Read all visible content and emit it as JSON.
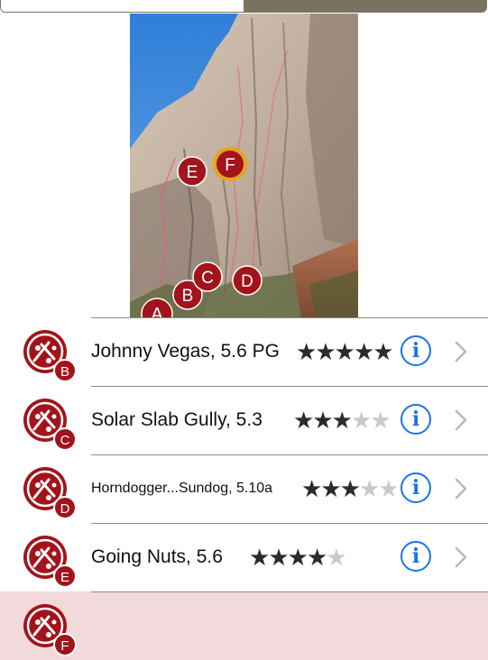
{
  "colors": {
    "marker_red": "#a3131b",
    "marker_gold": "#e8a21c",
    "info_blue": "#1a73e8",
    "selected_row": "#f1d9dc",
    "segment_fill": "#7a7260"
  },
  "photo": {
    "markers": [
      {
        "letter": "A"
      },
      {
        "letter": "B"
      },
      {
        "letter": "C"
      },
      {
        "letter": "D"
      },
      {
        "letter": "E"
      },
      {
        "letter": "F",
        "highlighted": true
      }
    ]
  },
  "routes": [
    {
      "name": "Johnny Vegas, 5.6 PG",
      "badge": "B",
      "rating": 5,
      "max_rating": 5,
      "icon": "route-marker-icon"
    },
    {
      "name": "Solar Slab Gully, 5.3",
      "badge": "C",
      "rating": 3,
      "max_rating": 5,
      "icon": "route-marker-icon"
    },
    {
      "name": "Horndogger...Sundog, 5.10a",
      "badge": "D",
      "rating": 3,
      "max_rating": 5,
      "icon": "route-marker-icon"
    },
    {
      "name": "Going Nuts, 5.6",
      "badge": "E",
      "rating": 4,
      "max_rating": 5,
      "icon": "route-marker-icon"
    },
    {
      "name": "",
      "badge": "F",
      "rating": 0,
      "max_rating": 5,
      "icon": "route-marker-icon",
      "selected": true
    }
  ],
  "icons": {
    "info": "info-icon",
    "chevron": "chevron-right-icon",
    "star": "star-icon"
  }
}
